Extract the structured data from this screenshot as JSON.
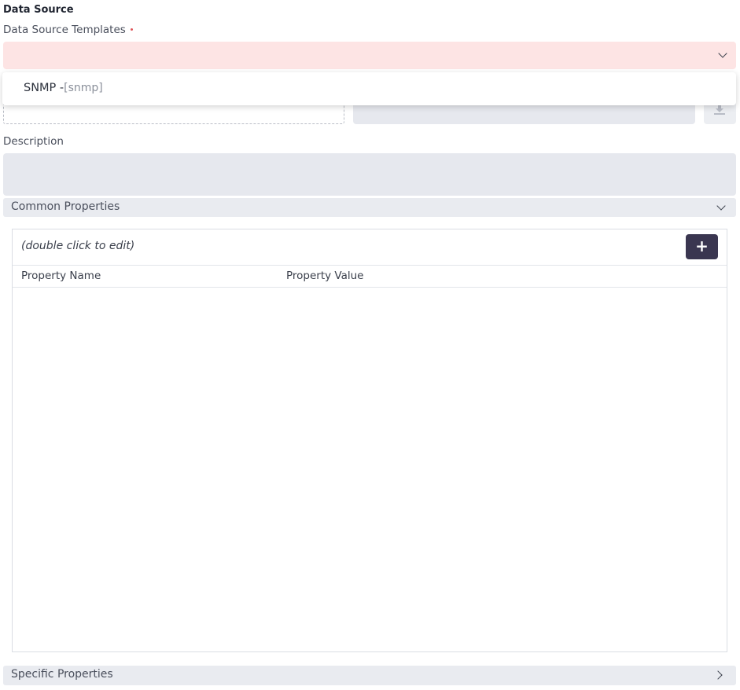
{
  "section": {
    "title": "Data Source"
  },
  "templates": {
    "label": "Data Source Templates",
    "selected_value": "",
    "options": [
      {
        "name": "SNMP -",
        "code": "[snmp]"
      }
    ]
  },
  "description": {
    "label": "Description",
    "value": ""
  },
  "common_properties": {
    "label": "Common Properties",
    "hint": "(double click to edit)",
    "add_label": "+",
    "columns": [
      "Property Name",
      "Property Value"
    ],
    "rows": []
  },
  "specific_properties": {
    "label": "Specific Properties"
  },
  "icons": {
    "select_chevron": "chevron-down-icon",
    "common_chevron": "chevron-down-icon",
    "specific_chevron": "chevron-right-icon",
    "download": "download-icon"
  },
  "colors": {
    "select_error_bg": "#fde4e4",
    "field_bg": "#e6e8ee",
    "add_button_bg": "#3a3650",
    "required_dot": "#e0555a"
  }
}
